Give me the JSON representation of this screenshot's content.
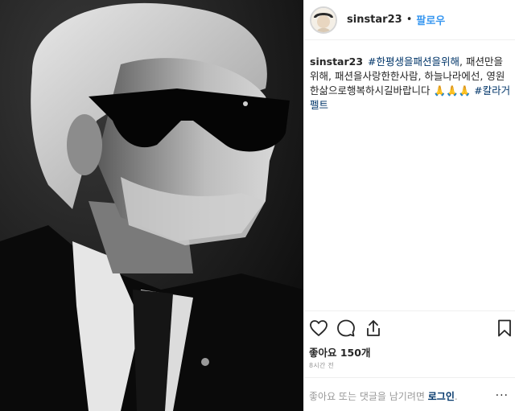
{
  "post": {
    "photo_icon": "portrait-photo",
    "header": {
      "username": "sinstar23",
      "separator": "•",
      "follow_label": "팔로우"
    },
    "caption": {
      "username": "sinstar23",
      "hashtag_1": "#한평생을패션을위해",
      "body": ", 패션만을위해, 패션을사랑한한사람, 하늘나라에선, 영원한삶으로행복하시길바랍니다 🙏🙏🙏 ",
      "hashtag_2": "#칼라거펠트"
    },
    "actions": {
      "like_icon": "heart-icon",
      "comment_icon": "comment-icon",
      "share_icon": "share-icon",
      "save_icon": "bookmark-icon"
    },
    "likes_text": "좋아요 150개",
    "time_text": "8시간 전",
    "comment_box": {
      "prompt": "좋아요 또는 댓글을 남기려면 ",
      "login_label": "로그인",
      "suffix": ".",
      "more_label": "···"
    },
    "colors": {
      "link_blue": "#3897f0",
      "hashtag_navy": "#003569",
      "muted_gray": "#999999"
    }
  }
}
